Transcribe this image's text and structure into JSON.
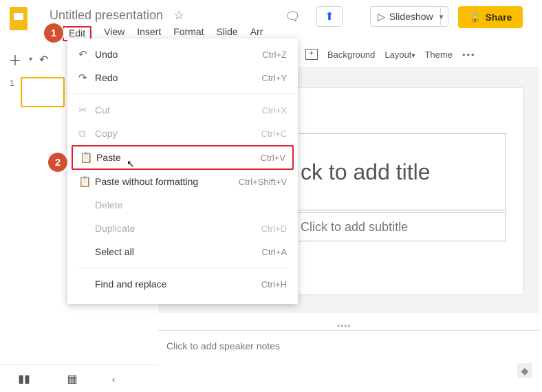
{
  "doc": {
    "name": "Untitled presentation"
  },
  "menubar": {
    "edit": "Edit",
    "view": "View",
    "insert": "Insert",
    "format": "Format",
    "slide": "Slide",
    "arrange_trunc": "Arr"
  },
  "top": {
    "slideshow": "Slideshow",
    "share": "Share"
  },
  "toolbar2": {
    "background": "Background",
    "layout": "Layout",
    "theme": "Theme"
  },
  "canvas": {
    "title_placeholder": "ck to add title",
    "subtitle_placeholder": "Click to add subtitle"
  },
  "notes": {
    "placeholder": "Click to add speaker notes"
  },
  "thumb": {
    "num": "1"
  },
  "badges": {
    "b1": "1",
    "b2": "2"
  },
  "menu": {
    "undo": {
      "label": "Undo",
      "sc": "Ctrl+Z"
    },
    "redo": {
      "label": "Redo",
      "sc": "Ctrl+Y"
    },
    "cut": {
      "label": "Cut",
      "sc": "Ctrl+X"
    },
    "copy": {
      "label": "Copy",
      "sc": "Ctrl+C"
    },
    "paste": {
      "label": "Paste",
      "sc": "Ctrl+V"
    },
    "paste_nf": {
      "label": "Paste without formatting",
      "sc": "Ctrl+Shift+V"
    },
    "delete": {
      "label": "Delete",
      "sc": ""
    },
    "duplicate": {
      "label": "Duplicate",
      "sc": "Ctrl+D"
    },
    "selectall": {
      "label": "Select all",
      "sc": "Ctrl+A"
    },
    "find": {
      "label": "Find and replace",
      "sc": "Ctrl+H"
    }
  }
}
